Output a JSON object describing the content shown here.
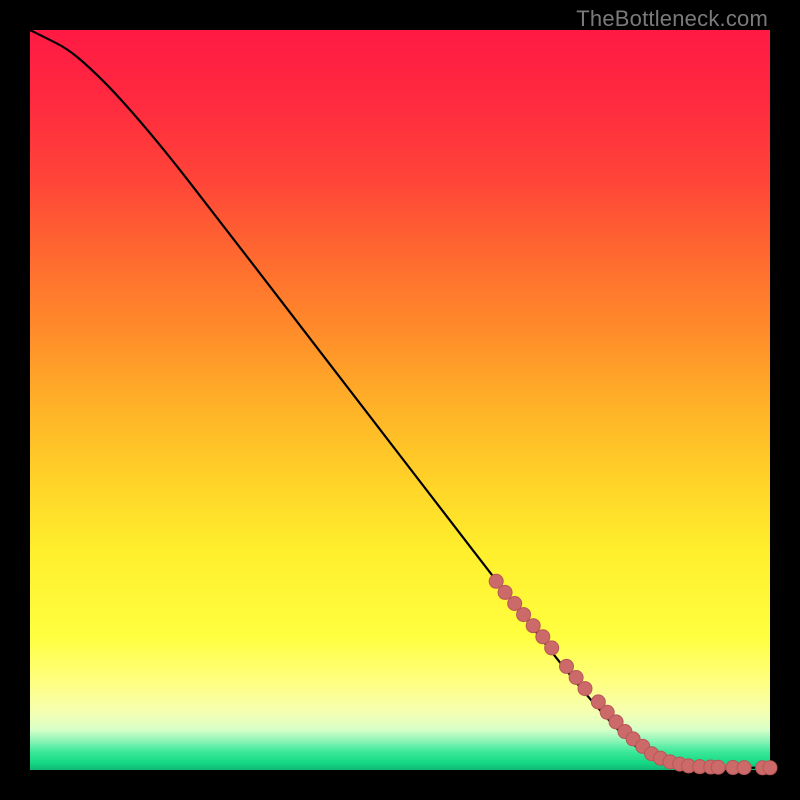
{
  "watermark": "TheBottleneck.com",
  "colors": {
    "border": "#000000",
    "curve": "#000000",
    "dot_fill": "#cc6a6a",
    "dot_stroke": "#b85757"
  },
  "gradient_stops": [
    {
      "pos": 0.0,
      "color": "#ff1a44"
    },
    {
      "pos": 0.1,
      "color": "#ff2b3f"
    },
    {
      "pos": 0.2,
      "color": "#ff4438"
    },
    {
      "pos": 0.3,
      "color": "#ff6830"
    },
    {
      "pos": 0.4,
      "color": "#ff8a2a"
    },
    {
      "pos": 0.5,
      "color": "#ffaf28"
    },
    {
      "pos": 0.6,
      "color": "#ffd028"
    },
    {
      "pos": 0.7,
      "color": "#ffee2c"
    },
    {
      "pos": 0.82,
      "color": "#ffff40"
    },
    {
      "pos": 0.88,
      "color": "#ffff80"
    },
    {
      "pos": 0.92,
      "color": "#f6ffb0"
    },
    {
      "pos": 0.945,
      "color": "#d8ffc8"
    },
    {
      "pos": 0.96,
      "color": "#8ff5b8"
    },
    {
      "pos": 0.975,
      "color": "#3de89a"
    },
    {
      "pos": 0.99,
      "color": "#16d985"
    },
    {
      "pos": 1.0,
      "color": "#0fb874"
    }
  ],
  "chart_data": {
    "type": "line",
    "title": "",
    "xlabel": "",
    "ylabel": "",
    "xlim": [
      0,
      100
    ],
    "ylim": [
      0,
      100
    ],
    "series": [
      {
        "name": "curve",
        "x": [
          0,
          2,
          5,
          8,
          12,
          18,
          25,
          35,
          45,
          55,
          65,
          72,
          76,
          80,
          83,
          86,
          88,
          90,
          92,
          95,
          100
        ],
        "y": [
          100,
          99,
          97.5,
          95,
          91,
          84,
          75,
          62,
          49,
          36,
          23,
          14,
          9.2,
          4.8,
          2.2,
          0.9,
          0.5,
          0.4,
          0.35,
          0.3,
          0.3
        ]
      }
    ],
    "dots": {
      "name": "highlighted-points",
      "x": [
        63,
        64.2,
        65.5,
        66.7,
        68,
        69.3,
        70.5,
        72.5,
        73.8,
        75,
        76.8,
        78,
        79.2,
        80.4,
        81.5,
        82.8,
        84,
        85.2,
        86.5,
        87.8,
        89,
        90.5,
        92,
        93,
        95,
        96.5,
        99,
        100
      ],
      "y": [
        25.5,
        24,
        22.5,
        21,
        19.5,
        18,
        16.5,
        14,
        12.5,
        11,
        9.2,
        7.8,
        6.5,
        5.2,
        4.2,
        3.2,
        2.2,
        1.6,
        1.1,
        0.8,
        0.55,
        0.45,
        0.4,
        0.38,
        0.33,
        0.32,
        0.3,
        0.3
      ]
    }
  }
}
